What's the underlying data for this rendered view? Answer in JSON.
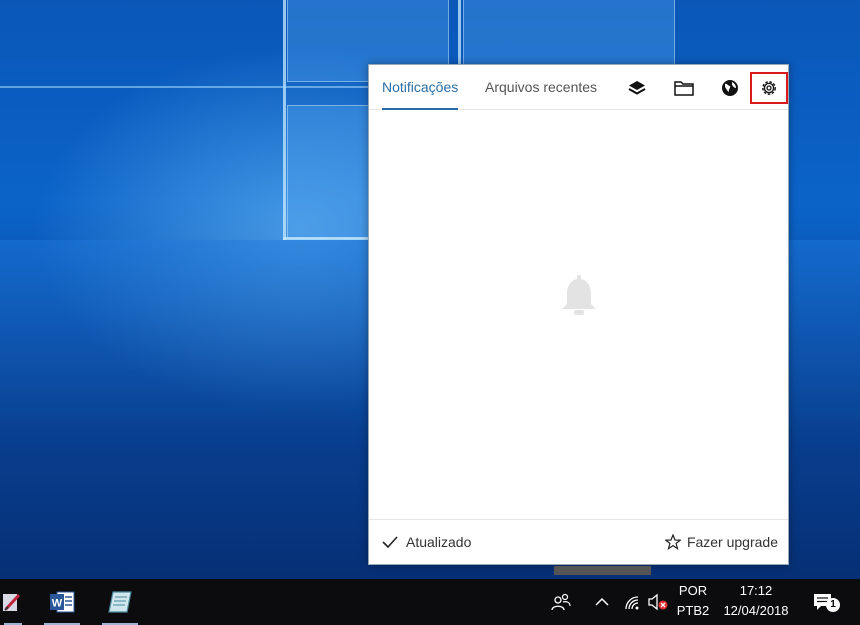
{
  "panel": {
    "tabs": [
      {
        "label": "Notificações",
        "active": true
      },
      {
        "label": "Arquivos recentes",
        "active": false
      }
    ],
    "header_icons": [
      "layers-icon",
      "folder-icon",
      "globe-icon",
      "settings-gear-icon"
    ],
    "empty_state_icon": "bell-icon",
    "footer": {
      "status_label": "Atualizado",
      "upgrade_label": "Fazer upgrade"
    }
  },
  "taskbar": {
    "apps": [
      "pen-app-icon",
      "word-icon",
      "notepad-icon"
    ],
    "tray_icons": [
      "people-icon",
      "chevron-up-icon",
      "wifi-icon",
      "volume-muted-icon",
      "action-center-icon"
    ],
    "language": {
      "line1": "POR",
      "line2": "PTB2"
    },
    "clock": {
      "time": "17:12",
      "date": "12/04/2018"
    },
    "notification_count": "1"
  },
  "colors": {
    "accent": "#2b6ea6",
    "highlight": "#d81a1a",
    "taskbar": "#0c0c0e"
  }
}
